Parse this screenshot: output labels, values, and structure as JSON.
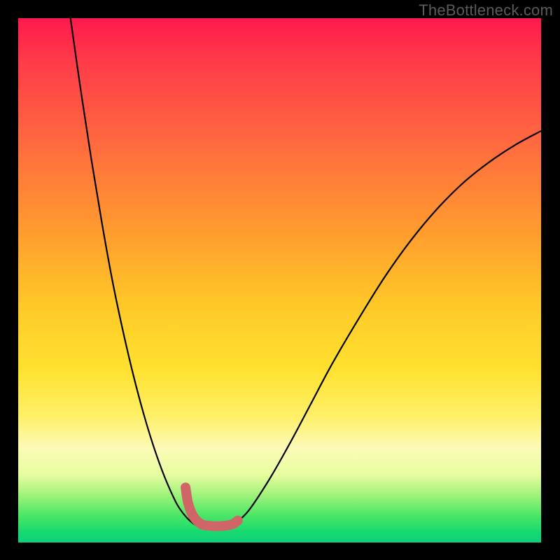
{
  "watermark": "TheBottleneck.com",
  "colors": {
    "curve": "#000000",
    "wiggle": "#cf6567",
    "frame": "#000000"
  },
  "chart_data": {
    "type": "line",
    "title": "",
    "xlabel": "",
    "ylabel": "",
    "xlim": [
      0,
      100
    ],
    "ylim": [
      0,
      100
    ],
    "grid": false,
    "legend": false,
    "series": [
      {
        "name": "left-curve",
        "x": [
          10.0,
          12.0,
          14.0,
          16.0,
          18.0,
          20.0,
          22.0,
          24.0,
          26.0,
          28.0,
          30.0,
          31.0,
          32.0,
          33.0,
          34.0,
          35.0
        ],
        "y": [
          100.0,
          86.0,
          73.0,
          61.0,
          50.0,
          40.5,
          32.0,
          24.5,
          18.0,
          12.5,
          8.0,
          6.3,
          5.0,
          4.0,
          3.3,
          3.0
        ]
      },
      {
        "name": "valley-floor",
        "x": [
          35.0,
          36.0,
          37.0,
          38.0,
          39.0,
          40.0,
          41.0
        ],
        "y": [
          3.0,
          2.8,
          2.7,
          2.7,
          2.8,
          3.0,
          3.2
        ]
      },
      {
        "name": "right-curve",
        "x": [
          41.0,
          44.0,
          48.0,
          52.0,
          56.0,
          60.0,
          65.0,
          70.0,
          75.0,
          80.0,
          85.0,
          90.0,
          95.0,
          100.0
        ],
        "y": [
          3.2,
          6.0,
          12.0,
          19.0,
          26.5,
          34.0,
          42.5,
          50.5,
          57.5,
          63.5,
          68.5,
          72.5,
          75.8,
          78.5
        ]
      }
    ],
    "annotations": [
      {
        "name": "highlight-wiggle",
        "type": "path",
        "color": "#cf6567",
        "points_x": [
          32.0,
          32.5,
          33.5,
          35.0,
          36.5,
          38.0,
          39.5,
          41.0,
          42.0
        ],
        "points_y": [
          10.5,
          7.5,
          5.0,
          3.5,
          3.2,
          3.1,
          3.2,
          3.5,
          4.2
        ]
      }
    ],
    "background_gradient": {
      "top": "#ff1a4d",
      "mid1": "#ff9a2f",
      "mid2": "#ffe12f",
      "mid3": "#fcfbb7",
      "bottom": "#17d96f"
    }
  }
}
